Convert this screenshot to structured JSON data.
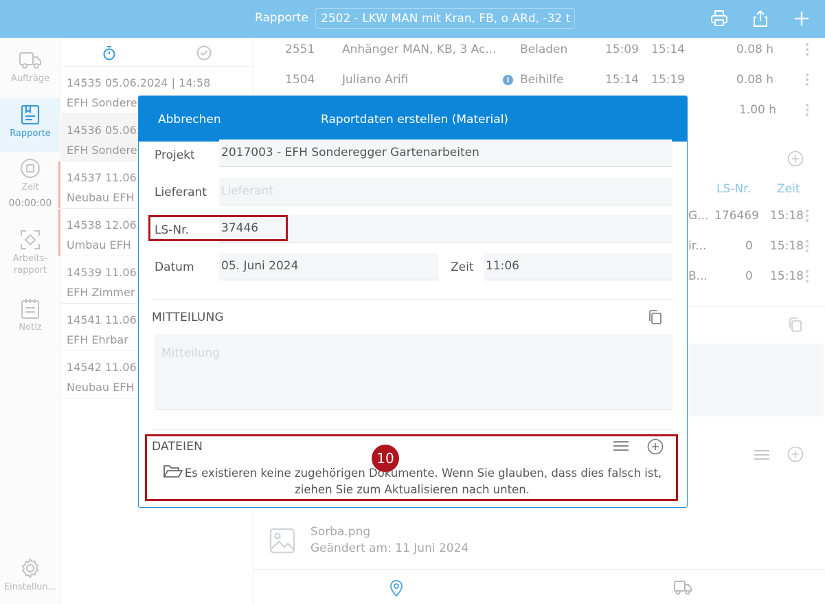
{
  "topbar": {
    "title": "Rapporte",
    "selected_vehicle": "2502 - LKW MAN mit Kran, FB, o ARd, -32 t",
    "icons": [
      "printer-icon",
      "share-icon",
      "plus-icon"
    ]
  },
  "nav": {
    "items": [
      {
        "label": "Aufträge",
        "icon": "truck-icon"
      },
      {
        "label": "Rapporte",
        "icon": "report-icon"
      },
      {
        "label": "Zeit",
        "icon": "timer-stop-icon",
        "value": "00:00:00"
      },
      {
        "label_line1": "Arbeits-",
        "label_line2": "rapport",
        "icon": "scan-icon"
      },
      {
        "label": "Notiz",
        "icon": "notepad-icon"
      },
      {
        "label": "Einstellun...",
        "icon": "gear-icon"
      }
    ]
  },
  "list": {
    "rows": [
      {
        "line1": "14535  05.06.2024 | 14:58",
        "line2": "EFH Sondere"
      },
      {
        "line1": "14536  05.06.",
        "line2": "EFH Sondere"
      },
      {
        "line1": "14537  11.06.",
        "line2": "Neubau EFH"
      },
      {
        "line1": "14538  12.06.",
        "line2": "Umbau EFH"
      },
      {
        "line1": "14539  11.06.",
        "line2": "EFH Zimmer"
      },
      {
        "line1": "14541  11.06.2",
        "line2": "EFH Ehrbar"
      },
      {
        "line1": "14542  11.06.",
        "line2": "Neubau EFH"
      }
    ]
  },
  "background_table": {
    "rows": [
      {
        "nr": "2551",
        "name": "Anhänger MAN, KB, 3 Ac...",
        "type": "Beladen",
        "from": "15:09",
        "to": "15:14",
        "hours": "0.08 h"
      },
      {
        "nr": "1504",
        "name": "Juliano Arifi",
        "type": "Beihilfe",
        "from": "15:14",
        "to": "15:19",
        "hours": "0.08 h"
      },
      {
        "hours": "1.00 h"
      }
    ],
    "material_headers": {
      "ls_nr": "LS-Nr.",
      "zeit": "Zeit"
    },
    "material_rows": [
      {
        "frag": "G...",
        "ls": "176469",
        "zeit": "15:18"
      },
      {
        "frag": "ir...",
        "ls": "0",
        "zeit": "15:18"
      },
      {
        "frag": "B...",
        "ls": "0",
        "zeit": "15:18"
      }
    ],
    "file": {
      "name": "Sorba.png",
      "changed": "Geändert am: 11 Juni 2024"
    }
  },
  "modal": {
    "cancel_label": "Abbrechen",
    "title": "Raportdaten erstellen (Material)",
    "fields": {
      "projekt_label": "Projekt",
      "projekt_value": "2017003 - EFH Sonderegger Gartenarbeiten",
      "lieferant_label": "Lieferant",
      "lieferant_placeholder": "Lieferant",
      "ls_label": "LS-Nr.",
      "ls_value": "37446",
      "datum_label": "Datum",
      "datum_value": "05. Juni 2024",
      "zeit_label": "Zeit",
      "zeit_value": "11:06"
    },
    "mitteilung": {
      "title": "MITTEILUNG",
      "placeholder": "Mitteilung"
    },
    "dateien": {
      "title": "DATEIEN",
      "empty_line1": "Es existieren keine zugehörigen Dokumente. Wenn Sie glauben, dass dies falsch ist,",
      "empty_line2": "ziehen Sie zum Aktualisieren nach unten."
    }
  },
  "annotation": {
    "badge": "10",
    "color": "#b0151f"
  },
  "colors": {
    "topbar": "#7ec3ec",
    "modal_header": "#0c86d8",
    "accent": "#3c9ad8"
  }
}
